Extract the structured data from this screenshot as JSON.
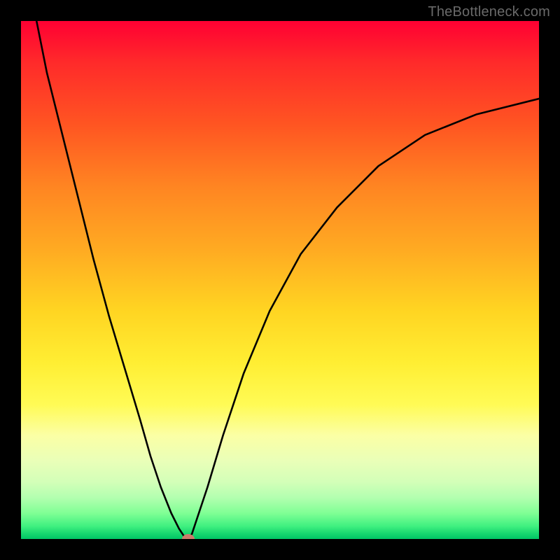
{
  "watermark": "TheBottleneck.com",
  "chart_data": {
    "type": "line",
    "title": "",
    "xlabel": "",
    "ylabel": "",
    "xlim": [
      0,
      100
    ],
    "ylim": [
      0,
      100
    ],
    "grid": false,
    "legend": false,
    "series": [
      {
        "name": "bottleneck-curve",
        "x": [
          3,
          5,
          8,
          11,
          14,
          17,
          20,
          23,
          25,
          27,
          29,
          30.5,
          31.5,
          32.3,
          33,
          34,
          36,
          39,
          43,
          48,
          54,
          61,
          69,
          78,
          88,
          100
        ],
        "values": [
          100,
          90,
          78,
          66,
          54,
          43,
          33,
          23,
          16,
          10,
          5,
          2,
          0.5,
          0,
          1,
          4,
          10,
          20,
          32,
          44,
          55,
          64,
          72,
          78,
          82,
          85
        ]
      }
    ],
    "marker": {
      "x": 32.3,
      "y": 0
    },
    "background_gradient": [
      {
        "pos": 0,
        "color": "#ff0033"
      },
      {
        "pos": 20,
        "color": "#ff5522"
      },
      {
        "pos": 44,
        "color": "#ffaa22"
      },
      {
        "pos": 66,
        "color": "#ffee33"
      },
      {
        "pos": 85,
        "color": "#d3ffb8"
      },
      {
        "pos": 100,
        "color": "#00c565"
      }
    ]
  }
}
